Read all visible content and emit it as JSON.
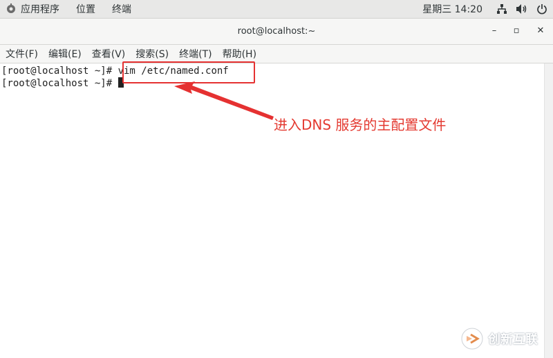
{
  "topbar": {
    "items": [
      {
        "label": "应用程序"
      },
      {
        "label": "位置"
      },
      {
        "label": "终端"
      }
    ],
    "clock": "星期三 14:20"
  },
  "window": {
    "title": "root@localhost:~",
    "minimize": "–",
    "maximize": "▫",
    "close": "✕"
  },
  "menubar": {
    "items": [
      {
        "label": "文件(F)"
      },
      {
        "label": "编辑(E)"
      },
      {
        "label": "查看(V)"
      },
      {
        "label": "搜索(S)"
      },
      {
        "label": "终端(T)"
      },
      {
        "label": "帮助(H)"
      }
    ]
  },
  "terminal": {
    "lines": [
      {
        "prompt": "[root@localhost ~]# ",
        "command": "vim /etc/named.conf"
      },
      {
        "prompt": "[root@localhost ~]# ",
        "command": ""
      }
    ]
  },
  "annotation": {
    "text": "进入DNS 服务的主配置文件",
    "color": "#e43a31"
  },
  "watermark": {
    "text": "创新互联"
  }
}
